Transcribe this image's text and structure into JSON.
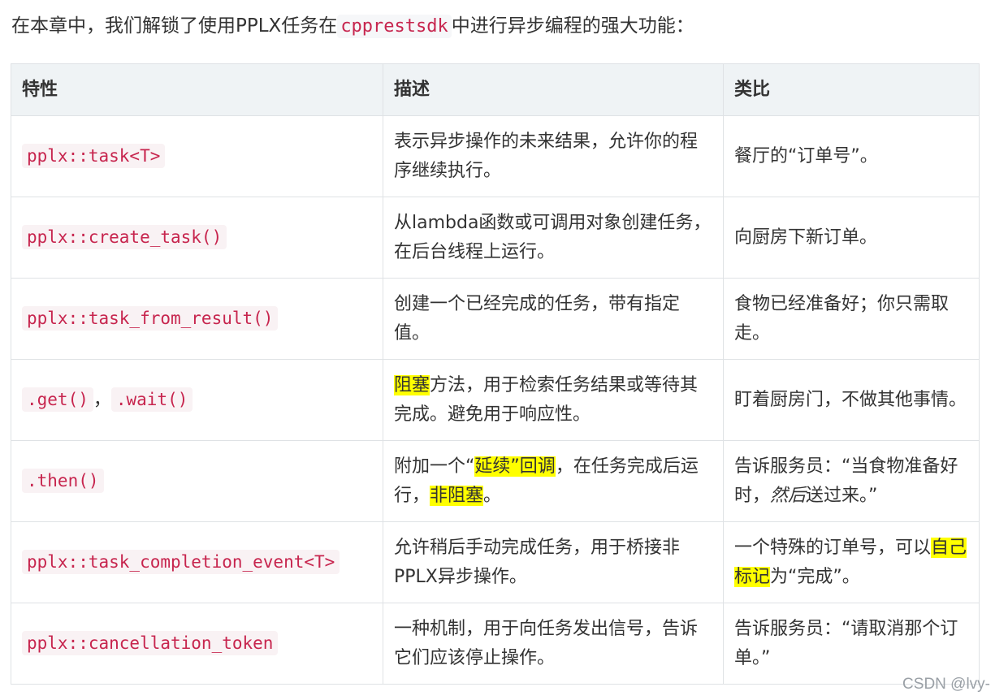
{
  "intro": {
    "before": "在本章中，我们解锁了使用PPLX任务在",
    "code": "cpprestsdk",
    "after": "中进行异步编程的强大功能："
  },
  "table": {
    "headers": [
      "特性",
      "描述",
      "类比"
    ],
    "rows": [
      {
        "feature": "pplx::task<T>",
        "desc": "表示异步操作的未来结果，允许你的程序继续执行。",
        "analogy": "餐厅的“订单号”。"
      },
      {
        "feature": "pplx::create_task()",
        "desc": "从lambda函数或可调用对象创建任务，在后台线程上运行。",
        "analogy": "向厨房下新订单。"
      },
      {
        "feature": "pplx::task_from_result()",
        "desc": "创建一个已经完成的任务，带有指定值。",
        "analogy": "食物已经准备好；你只需取走。"
      },
      {
        "feature_a": ".get()",
        "feature_sep": "，",
        "feature_b": ".wait()",
        "desc_hl": "阻塞",
        "desc_rest": "方法，用于检索任务结果或等待其完成。避免用于响应性。",
        "analogy": "盯着厨房门，不做其他事情。"
      },
      {
        "feature": ".then()",
        "desc_p1": "附加一个“",
        "desc_hl1": "延续”回调",
        "desc_p2": "，在任务完成后运行，",
        "desc_hl2": "非阻塞",
        "desc_p3": "。",
        "analogy_p1": "告诉服务员：“当食物准备好时，",
        "analogy_it": "然后",
        "analogy_p2": "送过来。”"
      },
      {
        "feature": "pplx::task_completion_event<T>",
        "desc": "允许稍后手动完成任务，用于桥接非PPLX异步操作。",
        "analogy_p1": "一个特殊的订单号，可以",
        "analogy_hl": "自己标记",
        "analogy_p2": "为“完成”。"
      },
      {
        "feature": "pplx::cancellation_token",
        "desc": "一种机制，用于向任务发出信号，告诉它们应该停止操作。",
        "analogy": "告诉服务员：“请取消那个订单。”"
      }
    ]
  },
  "watermark": "CSDN @lvy-",
  "colors": {
    "code_text": "#c7254e",
    "header_bg": "#eff3f5",
    "highlight": "#ffff00",
    "border": "#dfe2e5"
  }
}
